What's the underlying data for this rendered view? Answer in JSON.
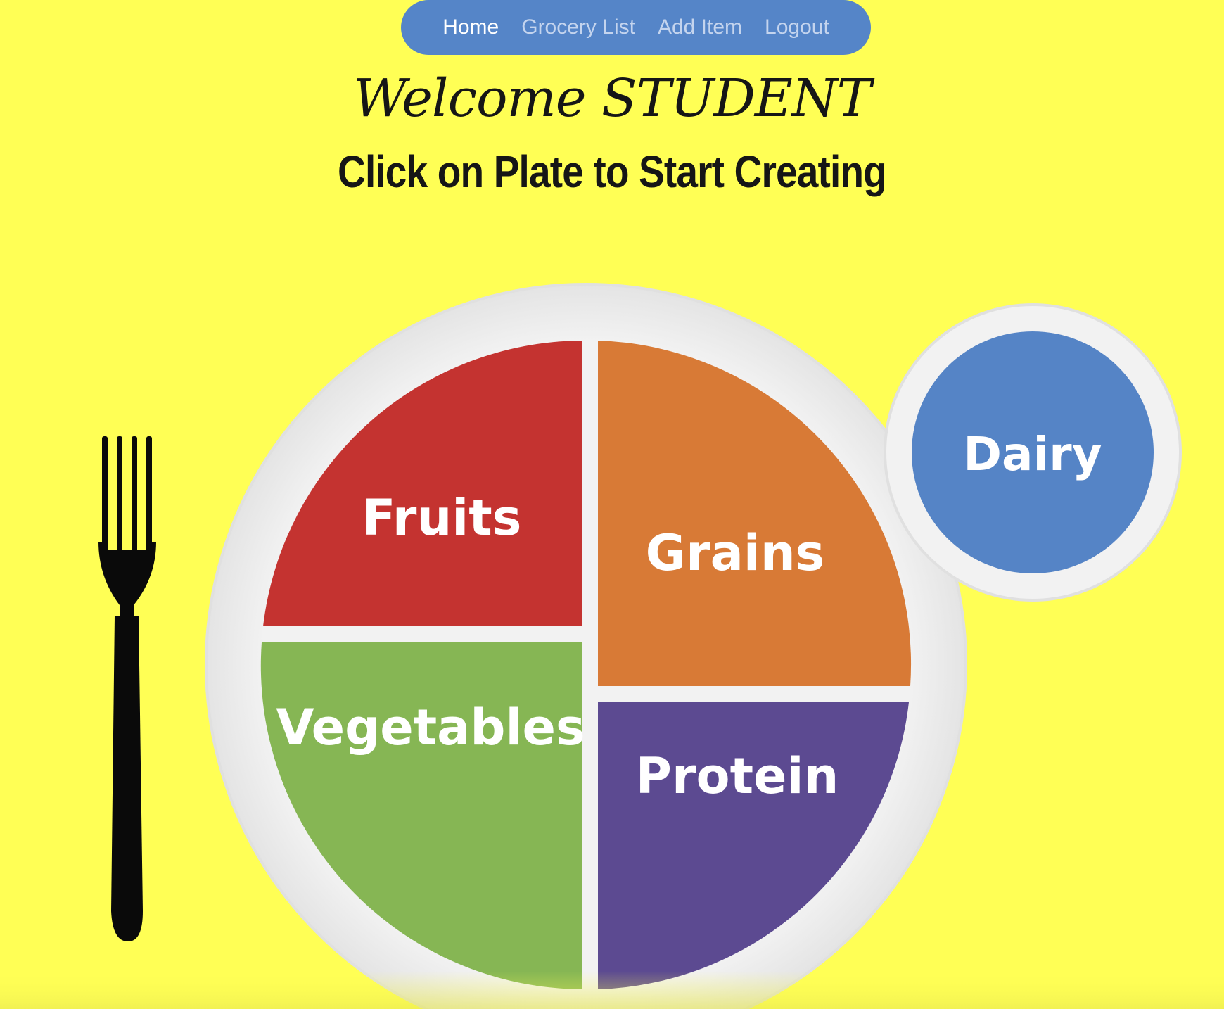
{
  "nav": {
    "items": [
      {
        "label": "Home",
        "active": true
      },
      {
        "label": "Grocery List",
        "active": false
      },
      {
        "label": "Add Item",
        "active": false
      },
      {
        "label": "Logout",
        "active": false
      }
    ],
    "color": "#5585c8"
  },
  "header": {
    "welcome": "Welcome STUDENT",
    "subtitle": "Click on Plate to Start Creating"
  },
  "plate": {
    "sections": {
      "fruits": {
        "label": "Fruits",
        "color": "#c43330"
      },
      "grains": {
        "label": "Grains",
        "color": "#d87a36"
      },
      "vegetables": {
        "label": "Vegetables",
        "color": "#86b654"
      },
      "protein": {
        "label": "Protein",
        "color": "#5c4a91"
      },
      "dairy": {
        "label": "Dairy",
        "color": "#5584c6"
      }
    },
    "utensil_icon": "fork-icon"
  },
  "colors": {
    "background": "#ffff55"
  }
}
